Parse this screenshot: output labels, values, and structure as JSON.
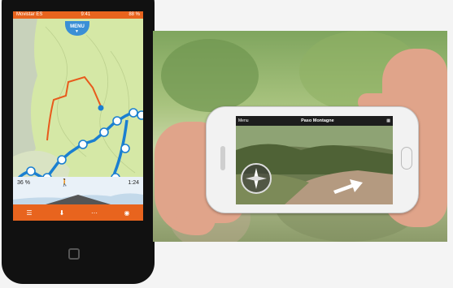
{
  "left_phone": {
    "status_bar": {
      "carrier": "Movistar ES",
      "time": "9:41",
      "battery": "88 %"
    },
    "menu_button": {
      "label": "MENU"
    },
    "info_bar": {
      "left_value": "36 %",
      "right_value": "1:24"
    },
    "tab_bar": {
      "tabs": [
        "list-icon",
        "pin-icon",
        "dots-icon",
        "camera-icon"
      ]
    },
    "colors": {
      "accent": "#e8641e",
      "route": "#1a7fd1",
      "track": "#e85a1c",
      "map": "#d5e8a6"
    }
  },
  "right_phone": {
    "nav_bar": {
      "back_label": "Menu",
      "title": "Paso Montagne",
      "right_icon": "grid-icon"
    }
  }
}
